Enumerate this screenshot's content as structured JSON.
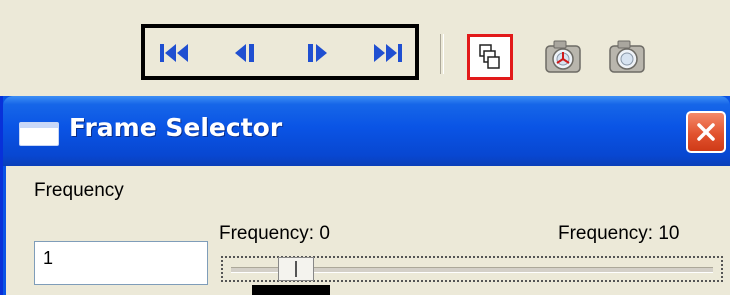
{
  "toolbar": {
    "nav_buttons": [
      {
        "icon": "skip-to-start-icon"
      },
      {
        "icon": "step-back-icon"
      },
      {
        "icon": "step-forward-icon"
      },
      {
        "icon": "skip-to-end-icon"
      }
    ],
    "tools": [
      {
        "icon": "frame-selector-icon",
        "active": true
      },
      {
        "icon": "camera-record-icon",
        "active": false
      },
      {
        "icon": "camera-icon",
        "active": false
      }
    ]
  },
  "dialog": {
    "title": "Frame Selector",
    "close_icon": "close-icon",
    "frequency_label": "Frequency",
    "frequency_value": "1",
    "slider": {
      "min_label": "Frequency: 0",
      "max_label": "Frequency: 10",
      "min": 0,
      "max": 10,
      "value": 1
    }
  },
  "colors": {
    "titlebar": "#0a54e5",
    "highlight": "#e21a1a",
    "nav_icon": "#1f4fd1",
    "window_bg": "#ece9d8"
  }
}
